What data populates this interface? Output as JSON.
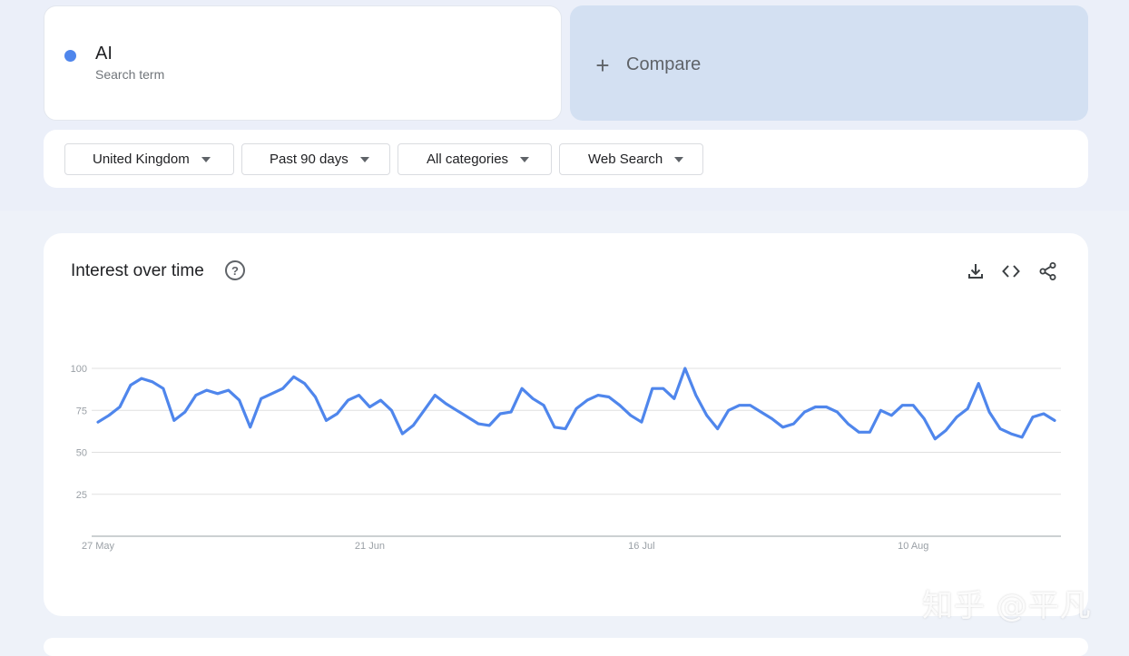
{
  "search_term": {
    "name": "AI",
    "subtitle": "Search term",
    "color": "#4f86ec"
  },
  "compare": {
    "label": "Compare",
    "icon": "plus-icon"
  },
  "filters": [
    {
      "label": "United Kingdom"
    },
    {
      "label": "Past 90 days"
    },
    {
      "label": "All categories"
    },
    {
      "label": "Web Search"
    }
  ],
  "panel": {
    "title": "Interest over time",
    "icons": [
      "help-icon",
      "download-icon",
      "embed-icon",
      "share-icon"
    ]
  },
  "watermark": "知乎 @平凡",
  "chart_data": {
    "type": "line",
    "title": "Interest over time",
    "xlabel": "",
    "ylabel": "",
    "ylim": [
      0,
      100
    ],
    "y_ticks": [
      25,
      50,
      75,
      100
    ],
    "x_ticks": [
      {
        "label": "27 May",
        "index": 0
      },
      {
        "label": "21 Jun",
        "index": 25
      },
      {
        "label": "16 Jul",
        "index": 50
      },
      {
        "label": "10 Aug",
        "index": 75
      }
    ],
    "grid": true,
    "line_color": "#4f86ec",
    "series": [
      {
        "values": [
          68,
          72,
          77,
          90,
          94,
          92,
          88,
          69,
          74,
          84,
          87,
          85,
          87,
          81,
          65,
          82,
          85,
          88,
          95,
          91,
          83,
          69,
          73,
          81,
          84,
          77,
          81,
          75,
          61,
          66,
          75,
          84,
          79,
          75,
          71,
          67,
          66,
          73,
          74,
          88,
          82,
          78,
          65,
          64,
          76,
          81,
          84,
          83,
          78,
          72,
          68,
          88,
          88,
          82,
          100,
          84,
          72,
          64,
          75,
          78,
          78,
          74,
          70,
          65,
          67,
          74,
          77,
          77,
          74,
          67,
          62,
          62,
          75,
          72,
          78,
          78,
          70,
          58,
          63,
          71,
          76,
          91,
          74,
          64,
          61,
          59,
          71,
          73,
          69
        ]
      }
    ]
  }
}
